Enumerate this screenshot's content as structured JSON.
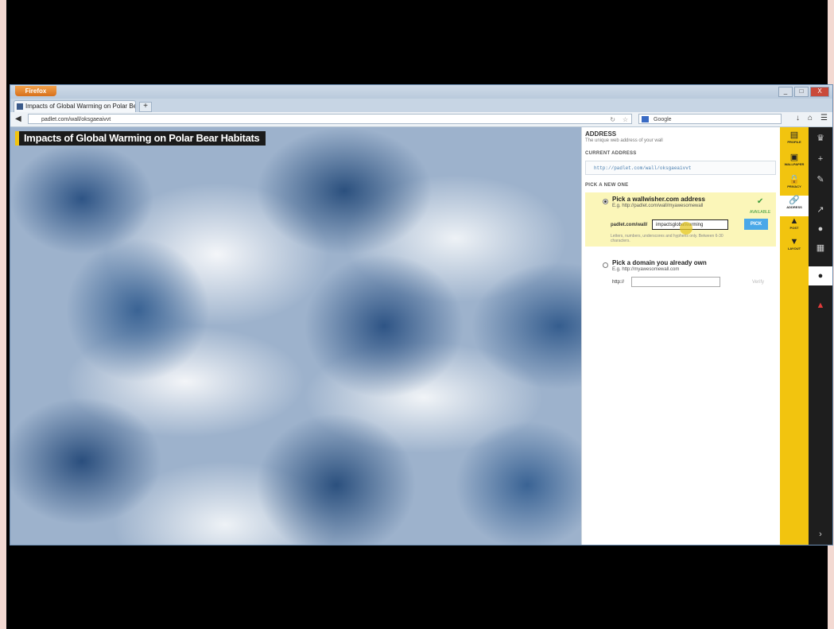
{
  "browser": {
    "menu_button": "Firefox",
    "tab_title": "Impacts of Global Warming on Polar Bea...",
    "new_tab": "+",
    "url": "padlet.com/wall/oksgaeaivvt",
    "search_engine": "Google",
    "win_controls": [
      "_",
      "□",
      "X"
    ]
  },
  "wall": {
    "title": "Impacts of Global Warming on Polar Bear Habitats"
  },
  "address_panel": {
    "heading": "ADDRESS",
    "subheading": "The unique web address of your wall",
    "current_label": "CURRENT ADDRESS",
    "current_url": "http://padlet.com/wall/oksgaeaivvt",
    "new_label": "PICK A NEW ONE",
    "option1": {
      "title": "Pick a wallwisher.com address",
      "example": "E.g. http://padlet.com/wall/myawesomewall",
      "availability": "AVAILABLE",
      "prefix": "padlet.com/wall/",
      "value": "impactsglobalwarming",
      "hint": "Letters, numbers, underscores and hyphens only. Between 6-30 characters.",
      "button": "PICK"
    },
    "option2": {
      "title": "Pick a domain you already own",
      "example": "E.g. http://myawesomewall.com",
      "field_label": "http://",
      "button": "Verify"
    }
  },
  "yellow_sidebar": [
    {
      "icon": "profile-icon",
      "glyph": "▤",
      "label": "PROFILE"
    },
    {
      "icon": "wallpaper-icon",
      "glyph": "▣",
      "label": "WALLPAPER"
    },
    {
      "icon": "privacy-icon",
      "glyph": "🔒",
      "label": "PRIVACY"
    },
    {
      "icon": "address-icon",
      "glyph": "🔗",
      "label": "ADDRESS"
    },
    {
      "icon": "post-icon",
      "glyph": "▲",
      "label": "POST"
    },
    {
      "icon": "layout-icon",
      "glyph": "▼",
      "label": "LAYOUT"
    }
  ],
  "dark_sidebar": [
    {
      "icon": "crown-icon",
      "glyph": "♛"
    },
    {
      "icon": "plus-icon",
      "glyph": "+"
    },
    {
      "icon": "wrench-icon",
      "glyph": "✎"
    },
    {
      "icon": "share-icon",
      "glyph": "↗"
    },
    {
      "icon": "info-icon",
      "glyph": "●"
    },
    {
      "icon": "grid-icon",
      "glyph": "▦"
    },
    {
      "icon": "circle-icon",
      "glyph": "●"
    },
    {
      "icon": "alert-icon",
      "glyph": "▲"
    },
    {
      "icon": "expand-icon",
      "glyph": "›"
    }
  ]
}
